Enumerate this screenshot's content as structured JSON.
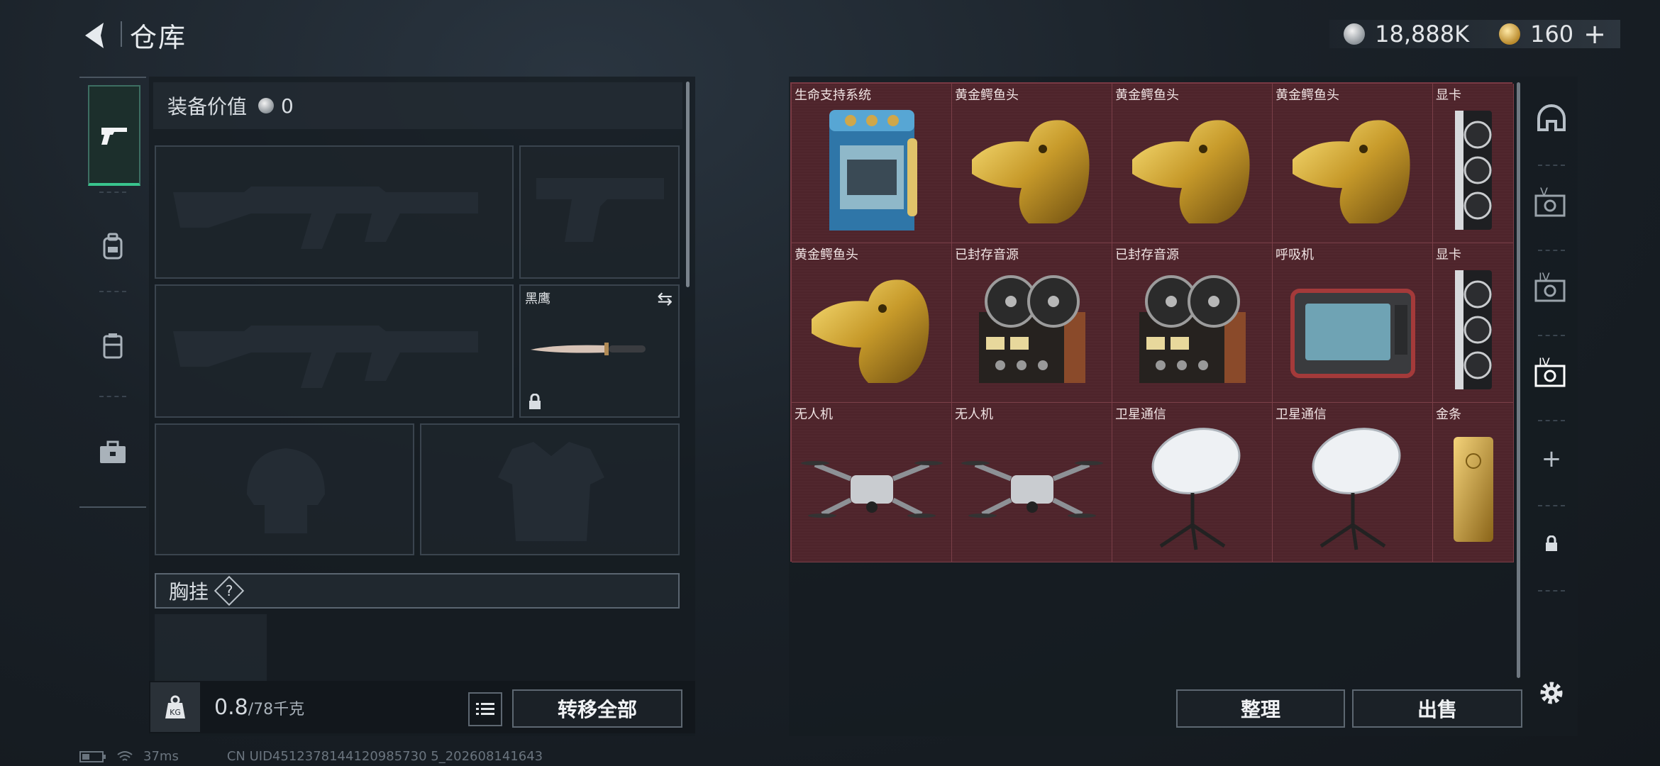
{
  "header": {
    "title": "仓库",
    "back_icon": "back-arrow-icon"
  },
  "currency": {
    "silver_amount": "18,888K",
    "gold_amount": "160",
    "add_label": "+"
  },
  "left_tabs": [
    "pistol-icon",
    "backpack-icon",
    "rig-icon",
    "toolbox-icon"
  ],
  "equip": {
    "label": "装备价值",
    "value": "0"
  },
  "knife_slot": {
    "label": "黑鹰"
  },
  "chest": {
    "label": "胸挂",
    "help": "?"
  },
  "footer": {
    "weight_icon_text": "KG",
    "weight_current": "0.8",
    "weight_sep": "/",
    "weight_max": "78千克",
    "transfer_all": "转移全部"
  },
  "stash": {
    "rows": [
      [
        "生命支持系统",
        "黄金鳄鱼头",
        "黄金鳄鱼头",
        "黄金鳄鱼头",
        "显卡"
      ],
      [
        "黄金鳄鱼头",
        "已封存音源",
        "已封存音源",
        "呼吸机",
        "显卡"
      ],
      [
        "无人机",
        "无人机",
        "卫星通信",
        "卫星通信",
        "金条"
      ]
    ]
  },
  "right_tabs": [
    "helmet-tab-icon",
    "armor-v-icon",
    "armor-iv-icon",
    "armor-iv-active-icon",
    "add-icon",
    "lock-icon"
  ],
  "actions": {
    "organize": "整理",
    "sell": "出售"
  },
  "status": {
    "ping": "37ms",
    "uid": "CN UID4512378144120985730 5_202608141643"
  },
  "colors": {
    "accent_green": "#39c48d",
    "stash_bg": "#4e242b"
  }
}
